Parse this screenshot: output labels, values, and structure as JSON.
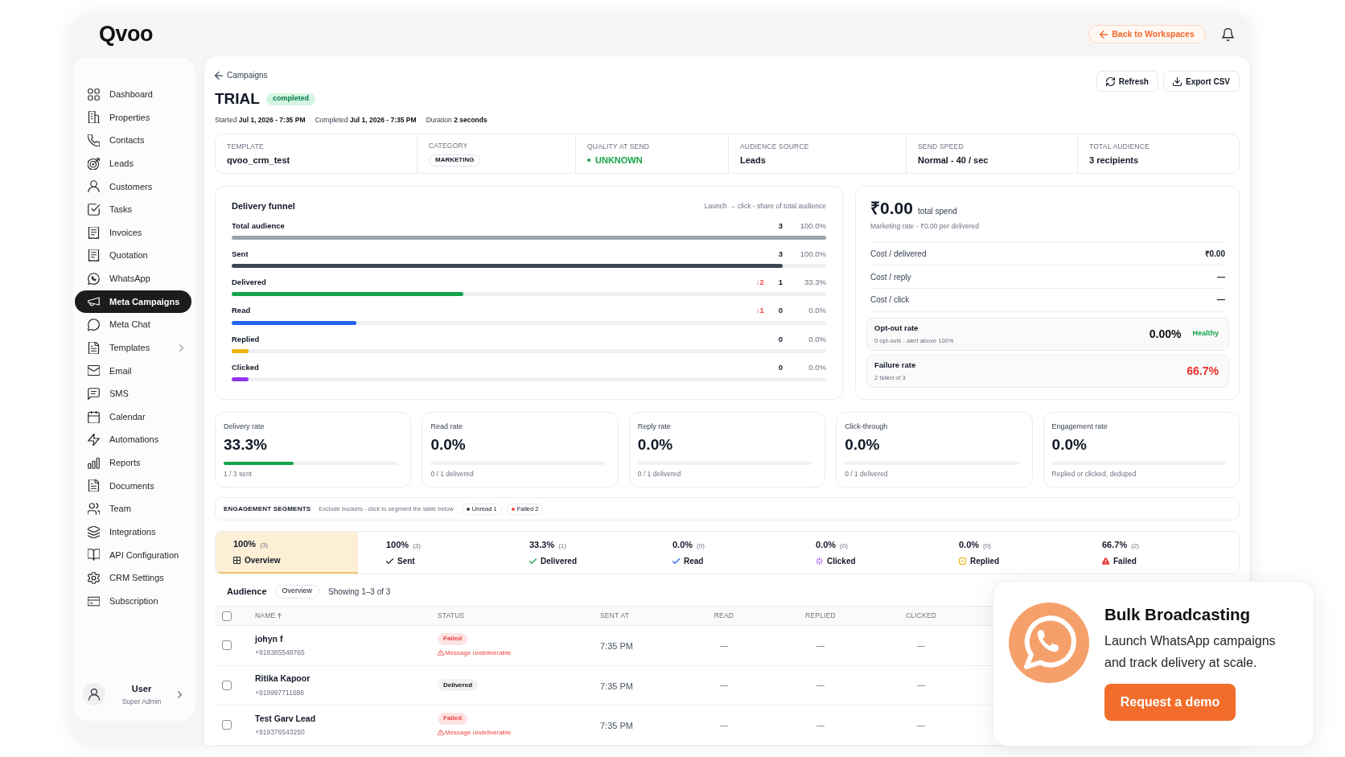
{
  "header": {
    "logo": "Qvoo",
    "back_button": "Back to Workspaces"
  },
  "sidebar": {
    "items": [
      {
        "label": "Dashboard",
        "selected": false,
        "expandable": false
      },
      {
        "label": "Properties",
        "selected": false,
        "expandable": false
      },
      {
        "label": "Contacts",
        "selected": false,
        "expandable": false
      },
      {
        "label": "Leads",
        "selected": false,
        "expandable": false
      },
      {
        "label": "Customers",
        "selected": false,
        "expandable": false
      },
      {
        "label": "Tasks",
        "selected": false,
        "expandable": false
      },
      {
        "label": "Invoices",
        "selected": false,
        "expandable": false
      },
      {
        "label": "Quotation",
        "selected": false,
        "expandable": false
      },
      {
        "label": "WhatsApp",
        "selected": false,
        "expandable": false
      },
      {
        "label": "Meta Campaigns",
        "selected": true,
        "expandable": false
      },
      {
        "label": "Meta Chat",
        "selected": false,
        "expandable": false
      },
      {
        "label": "Templates",
        "selected": false,
        "expandable": true
      },
      {
        "label": "Email",
        "selected": false,
        "expandable": false
      },
      {
        "label": "SMS",
        "selected": false,
        "expandable": false
      },
      {
        "label": "Calendar",
        "selected": false,
        "expandable": false
      },
      {
        "label": "Automations",
        "selected": false,
        "expandable": false
      },
      {
        "label": "Reports",
        "selected": false,
        "expandable": false
      },
      {
        "label": "Documents",
        "selected": false,
        "expandable": false
      },
      {
        "label": "Team",
        "selected": false,
        "expandable": false
      },
      {
        "label": "Integrations",
        "selected": false,
        "expandable": false
      },
      {
        "label": "API Configuration",
        "selected": false,
        "expandable": false
      },
      {
        "label": "CRM Settings",
        "selected": false,
        "expandable": false
      },
      {
        "label": "Subscription",
        "selected": false,
        "expandable": false
      }
    ],
    "user": {
      "name": "User",
      "role": "Super Admin"
    }
  },
  "campaign": {
    "back_link": "Campaigns",
    "title": "TRIAL",
    "status": "completed",
    "meta": [
      {
        "label": "Started",
        "value": "Jul 1, 2026 - 7:35 PM"
      },
      {
        "label": "Completed",
        "value": "Jul 1, 2026 - 7:35 PM"
      },
      {
        "label": "Duration",
        "value": "2 seconds"
      }
    ],
    "actions": [
      {
        "label": "Refresh",
        "kind": "refresh"
      },
      {
        "label": "Export CSV",
        "kind": "export"
      }
    ]
  },
  "details": [
    {
      "label": "TEMPLATE",
      "value": "qvoo_crm_test",
      "kind": "text"
    },
    {
      "label": "CATEGORY",
      "value": "MARKETING",
      "kind": "tag"
    },
    {
      "label": "QUALITY AT SEND",
      "value": "UNKNOWN",
      "kind": "status"
    },
    {
      "label": "AUDIENCE SOURCE",
      "value": "Leads",
      "kind": "text"
    },
    {
      "label": "SEND SPEED",
      "value": "Normal - 40 / sec",
      "kind": "text"
    },
    {
      "label": "TOTAL AUDIENCE",
      "value": "3 recipients",
      "kind": "text"
    }
  ],
  "funnel": {
    "title": "Delivery funnel",
    "subtitle": "Launch → click - share of total audience",
    "rows": [
      {
        "label": "Total audience",
        "count": "3",
        "percent": "100.0%",
        "level": 1,
        "color": "#9ca3af"
      },
      {
        "label": "Sent",
        "count": "3",
        "percent": "100.0%",
        "level": 0.927,
        "color": "#3f4654"
      },
      {
        "label": "Delivered",
        "drop": "↓2",
        "count": "1",
        "percent": "33.3%",
        "level": 0.39,
        "color": "#16a34a"
      },
      {
        "label": "Read",
        "drop": "↓1",
        "count": "0",
        "percent": "0.0%",
        "level": 0.21,
        "color": "#2563eb"
      },
      {
        "label": "Replied",
        "count": "0",
        "percent": "0.0%",
        "level": 0.028,
        "color": "#eab308"
      },
      {
        "label": "Clicked",
        "count": "0",
        "percent": "0.0%",
        "level": 0.028,
        "color": "#9333ea"
      }
    ]
  },
  "spend": {
    "amount": "₹0.00",
    "amount_label": "total spend",
    "subtitle": "Marketing rate - ₹0.00 per delivered",
    "costs": [
      {
        "label": "Cost / delivered",
        "value": "₹0.00"
      },
      {
        "label": "Cost / reply",
        "value": "—"
      },
      {
        "label": "Cost / click",
        "value": "—"
      }
    ],
    "rates": [
      {
        "label": "Opt-out rate",
        "note": "0 opt-outs - alert above 100%",
        "value": "0.00%",
        "badge": "Healthy",
        "kind": "ok"
      },
      {
        "label": "Failure rate",
        "note": "2 failed of 3",
        "value": "66.7%",
        "kind": "alert"
      }
    ]
  },
  "rate_cards": [
    {
      "label": "Delivery rate",
      "value": "33.3%",
      "level": 0.4,
      "note": "1 / 3 sent"
    },
    {
      "label": "Read rate",
      "value": "0.0%",
      "note": "0 / 1 delivered"
    },
    {
      "label": "Reply rate",
      "value": "0.0%",
      "note": "0 / 1 delivered"
    },
    {
      "label": "Click-through",
      "value": "0.0%",
      "note": "0 / 1 delivered"
    },
    {
      "label": "Engagement rate",
      "value": "0.0%",
      "note": "Replied or clicked, deduped"
    }
  ],
  "segments_bar": {
    "title": "ENGAGEMENT SEGMENTS",
    "hint": "Exclude buckets - click to segment the table below",
    "chips": [
      {
        "label": "Unread 1",
        "color": "#374151"
      },
      {
        "label": "Failed 2",
        "color": "#ef4444"
      }
    ]
  },
  "segment_tabs": [
    {
      "percent": "100%",
      "count": "(3)",
      "label": "Overview",
      "selected": true,
      "color": "#27272a"
    },
    {
      "percent": "100%",
      "count": "(3)",
      "label": "Sent",
      "selected": false,
      "color": "#27272a"
    },
    {
      "percent": "33.3%",
      "count": "(1)",
      "label": "Delivered",
      "selected": false,
      "color": "#16a34a"
    },
    {
      "percent": "0.0%",
      "count": "(0)",
      "label": "Read",
      "selected": false,
      "color": "#2563eb"
    },
    {
      "percent": "0.0%",
      "count": "(0)",
      "label": "Clicked",
      "selected": false,
      "color": "#a855f7"
    },
    {
      "percent": "0.0%",
      "count": "(0)",
      "label": "Replied",
      "selected": false,
      "color": "#eab308"
    },
    {
      "percent": "66.7%",
      "count": "(2)",
      "label": "Failed",
      "selected": false,
      "color": "#ef4444"
    }
  ],
  "audience": {
    "title": "Audience",
    "filter": "Overview",
    "showing": "Showing 1–3 of 3",
    "select_all_checked": false,
    "columns": [
      {
        "label": "NAME",
        "sorted": true
      },
      {
        "label": "STATUS",
        "sorted": false
      },
      {
        "label": "SENT AT",
        "sorted": false
      },
      {
        "label": "READ",
        "sorted": false
      },
      {
        "label": "REPLIED",
        "sorted": false
      },
      {
        "label": "CLICKED",
        "sorted": false
      }
    ],
    "rows": [
      {
        "checked": false,
        "name": "johyn f",
        "phone": "+918385548765",
        "status": {
          "label": "Failed",
          "kind": "failed",
          "error": "Message undeliverable"
        },
        "sent_at": "7:35 PM",
        "read": "—",
        "replied": "—",
        "clicked": "—"
      },
      {
        "checked": false,
        "name": "Ritika Kapoor",
        "phone": "+919997711686",
        "status": {
          "label": "Delivered",
          "kind": "delivered"
        },
        "sent_at": "7:35 PM",
        "read": "—",
        "replied": "—",
        "clicked": "—"
      },
      {
        "checked": false,
        "name": "Test Garv Lead",
        "phone": "+919376543250",
        "status": {
          "label": "Failed",
          "kind": "failed",
          "error": "Message undeliverable"
        },
        "sent_at": "7:35 PM",
        "read": "—",
        "replied": "—",
        "clicked": "—"
      }
    ]
  },
  "promo": {
    "title": "Bulk Broadcasting",
    "text": "Launch WhatsApp campaigns and track delivery at scale.",
    "button": "Request a demo"
  }
}
